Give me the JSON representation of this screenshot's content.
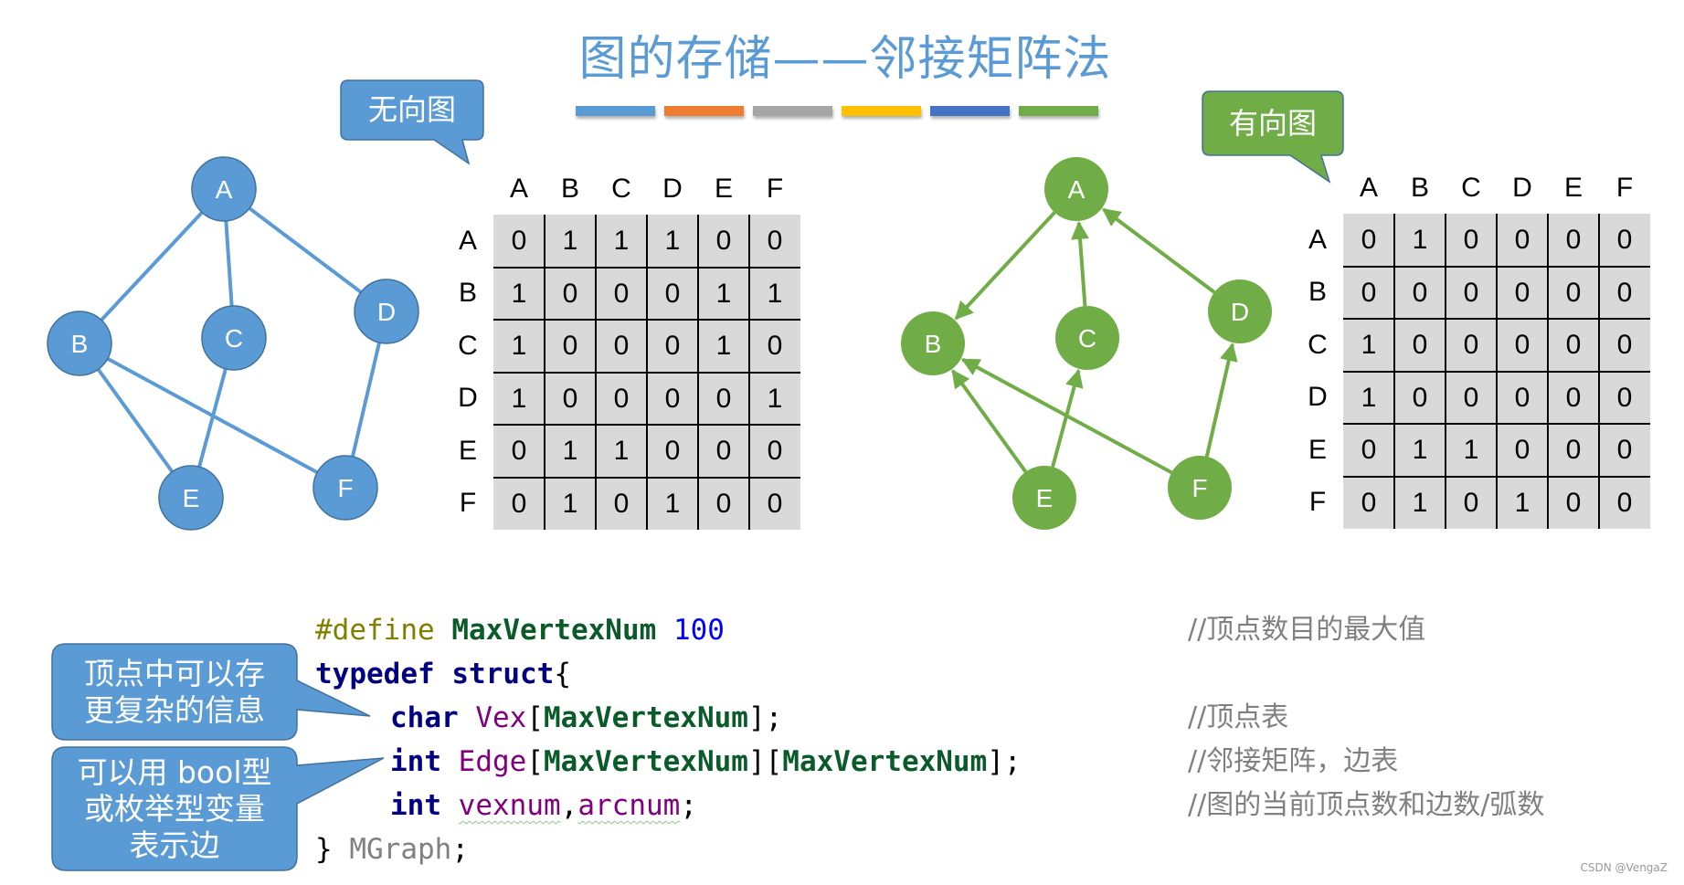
{
  "title": "图的存储——邻接矩阵法",
  "accent_bars": [
    "#5B9BD5",
    "#ED7D31",
    "#A5A5A5",
    "#FFC000",
    "#4472C4",
    "#70AD47"
  ],
  "undirected": {
    "callout": "无向图",
    "color": "#5B9BD5",
    "nodes": [
      "A",
      "B",
      "C",
      "D",
      "E",
      "F"
    ],
    "edges": [
      [
        "A",
        "B"
      ],
      [
        "A",
        "C"
      ],
      [
        "A",
        "D"
      ],
      [
        "B",
        "E"
      ],
      [
        "B",
        "F"
      ],
      [
        "C",
        "E"
      ],
      [
        "D",
        "F"
      ]
    ],
    "matrix": {
      "col_headers": [
        "A",
        "B",
        "C",
        "D",
        "E",
        "F"
      ],
      "row_headers": [
        "A",
        "B",
        "C",
        "D",
        "E",
        "F"
      ],
      "rows": [
        [
          "0",
          "1",
          "1",
          "1",
          "0",
          "0"
        ],
        [
          "1",
          "0",
          "0",
          "0",
          "1",
          "1"
        ],
        [
          "1",
          "0",
          "0",
          "0",
          "1",
          "0"
        ],
        [
          "1",
          "0",
          "0",
          "0",
          "0",
          "1"
        ],
        [
          "0",
          "1",
          "1",
          "0",
          "0",
          "0"
        ],
        [
          "0",
          "1",
          "0",
          "1",
          "0",
          "0"
        ]
      ]
    }
  },
  "directed": {
    "callout": "有向图",
    "color": "#70AD47",
    "nodes": [
      "A",
      "B",
      "C",
      "D",
      "E",
      "F"
    ],
    "arcs": [
      [
        "A",
        "B"
      ],
      [
        "C",
        "A"
      ],
      [
        "D",
        "A"
      ],
      [
        "E",
        "B"
      ],
      [
        "E",
        "C"
      ],
      [
        "F",
        "B"
      ],
      [
        "F",
        "D"
      ]
    ],
    "matrix": {
      "col_headers": [
        "A",
        "B",
        "C",
        "D",
        "E",
        "F"
      ],
      "row_headers": [
        "A",
        "B",
        "C",
        "D",
        "E",
        "F"
      ],
      "rows": [
        [
          "0",
          "1",
          "0",
          "0",
          "0",
          "0"
        ],
        [
          "0",
          "0",
          "0",
          "0",
          "0",
          "0"
        ],
        [
          "1",
          "0",
          "0",
          "0",
          "0",
          "0"
        ],
        [
          "1",
          "0",
          "0",
          "0",
          "0",
          "0"
        ],
        [
          "0",
          "1",
          "1",
          "0",
          "0",
          "0"
        ],
        [
          "0",
          "1",
          "0",
          "1",
          "0",
          "0"
        ]
      ]
    }
  },
  "code": {
    "line1": {
      "pp": "#define",
      "macro": "MaxVertexNum",
      "num": "100"
    },
    "line2": {
      "kw1": "typedef",
      "kw2": "struct",
      "brace": "{"
    },
    "line3": {
      "kw": "char",
      "var": "Vex",
      "open": "[",
      "macro": "MaxVertexNum",
      "close": "];"
    },
    "line4": {
      "kw": "int",
      "var": "Edge",
      "open1": "[",
      "macro1": "MaxVertexNum",
      "mid": "][",
      "macro2": "MaxVertexNum",
      "close": "];"
    },
    "line5": {
      "kw": "int",
      "var1": "vexnum",
      "sep": ",",
      "var2": "arcnum",
      "end": ";"
    },
    "line6": {
      "brace": "}",
      "type": "MGraph",
      "end": ";"
    }
  },
  "comments": [
    "//顶点数目的最大值",
    "//顶点表",
    "//邻接矩阵，边表",
    "//图的当前顶点数和边数/弧数"
  ],
  "notes": {
    "vertex_note": [
      "顶点中可以存",
      "更复杂的信息"
    ],
    "edge_note": [
      "可以用 bool型",
      "或枚举型变量",
      "表示边"
    ]
  },
  "watermark": "CSDN @VengaZ"
}
